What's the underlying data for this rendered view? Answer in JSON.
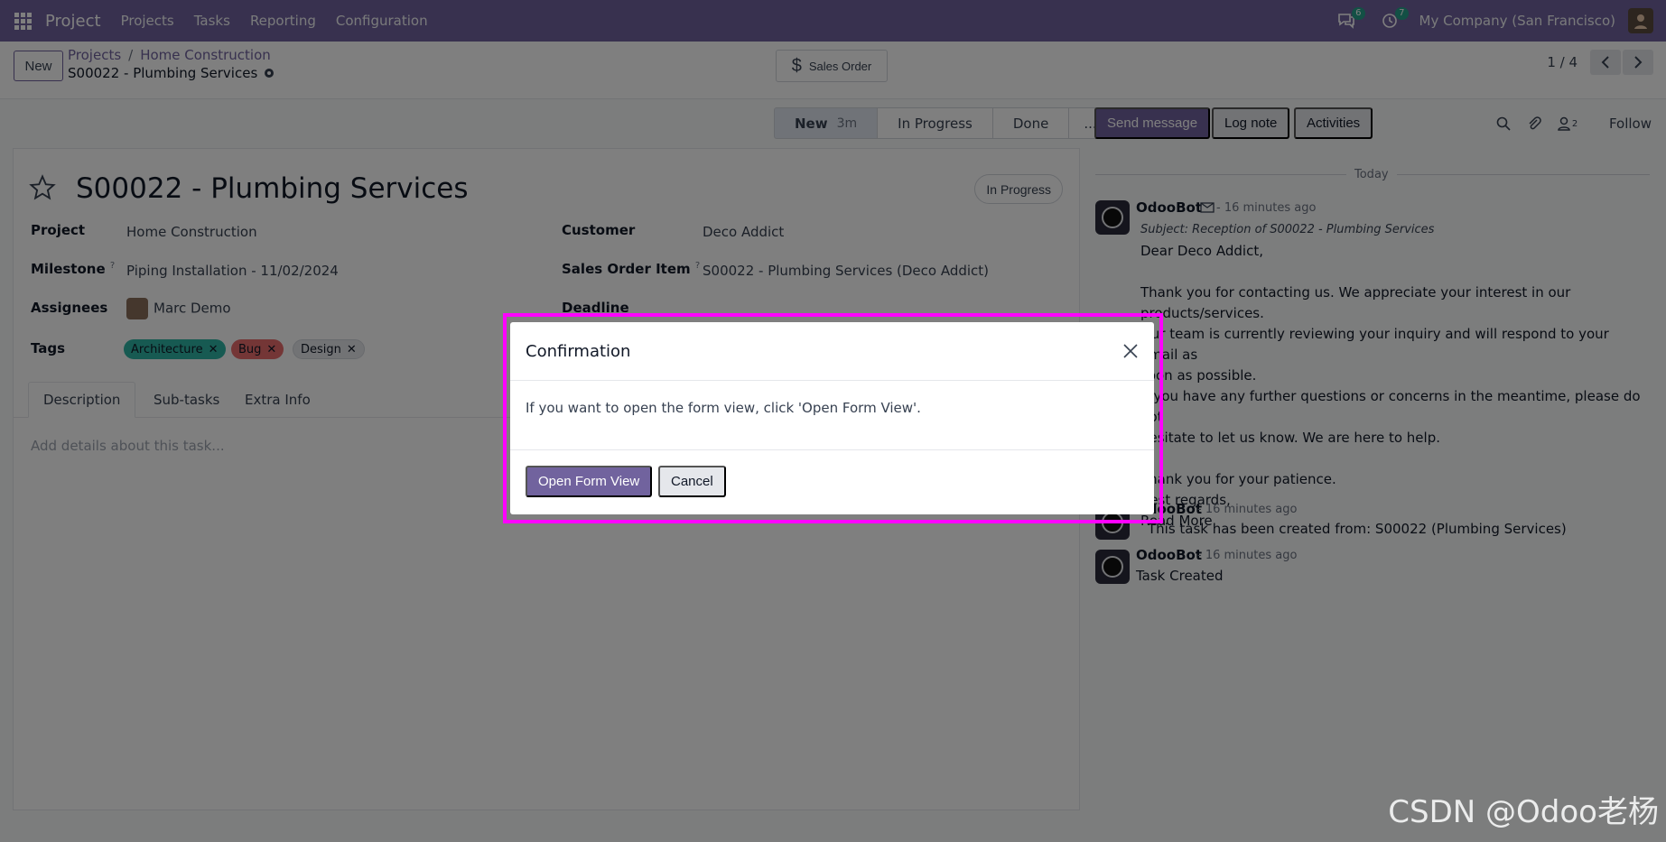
{
  "navbar": {
    "app_name": "Project",
    "menu": [
      "Projects",
      "Tasks",
      "Reporting",
      "Configuration"
    ],
    "chat_badge": "6",
    "activity_badge": "7",
    "company": "My Company (San Francisco)"
  },
  "control": {
    "new_label": "New",
    "breadcrumb": [
      "Projects",
      "Home Construction"
    ],
    "record_name": "S00022 - Plumbing Services",
    "sales_order_label": "Sales Order",
    "pager": "1 / 4"
  },
  "statusbar": {
    "stages": [
      "New",
      "In Progress",
      "Done",
      "..."
    ],
    "current_time": "3m"
  },
  "form": {
    "title": "S00022 - Plumbing Services",
    "state_button": "In Progress",
    "fields": {
      "project_label": "Project",
      "project_value": "Home Construction",
      "milestone_label": "Milestone",
      "milestone_value": "Piping Installation - 11/02/2024",
      "assignees_label": "Assignees",
      "assignees_value": "Marc Demo",
      "tags_label": "Tags",
      "customer_label": "Customer",
      "customer_value": "Deco Addict",
      "soi_label": "Sales Order Item",
      "soi_value": "S00022 - Plumbing Services (Deco Addict)",
      "deadline_label": "Deadline",
      "help_mark": "?"
    },
    "tags": [
      {
        "label": "Architecture",
        "color": "#2eb5a5"
      },
      {
        "label": "Bug",
        "color": "#e86c6c"
      },
      {
        "label": "Design",
        "color": "#e5e7eb"
      }
    ],
    "tabs": [
      "Description",
      "Sub-tasks",
      "Extra Info"
    ],
    "description_placeholder": "Add details about this task..."
  },
  "chatter": {
    "send_message": "Send message",
    "log_note": "Log note",
    "activities": "Activities",
    "followers_count": "2",
    "follow": "Follow",
    "today": "Today",
    "messages": [
      {
        "author": "OdooBot",
        "meta": "- 16 minutes ago",
        "subject": "Subject: Reception of S00022 - Plumbing Services",
        "lines": [
          "Dear Deco Addict,",
          "",
          "Thank you for contacting us. We appreciate your interest in our",
          "products/services.",
          "Our team is currently reviewing your inquiry and will respond to your email as",
          "soon as possible.",
          "If you have any further questions or concerns in the meantime, please do not",
          "hesitate to let us know. We are here to help.",
          "",
          "Thank you for your patience.",
          "Best regards,",
          "Read More"
        ]
      },
      {
        "author": "OdooBot",
        "meta": "- 16 minutes ago",
        "body": "This task has been created from: S00022 (Plumbing Services)"
      },
      {
        "author": "OdooBot",
        "meta": "- 16 minutes ago",
        "body": "Task Created"
      }
    ]
  },
  "dialog": {
    "title": "Confirmation",
    "message": "If you want to open the form view, click 'Open Form View'.",
    "primary": "Open Form View",
    "cancel": "Cancel"
  },
  "watermark": "CSDN @Odoo老杨",
  "colors": {
    "brand": "#71639e",
    "highlight": "#ff00ff"
  }
}
